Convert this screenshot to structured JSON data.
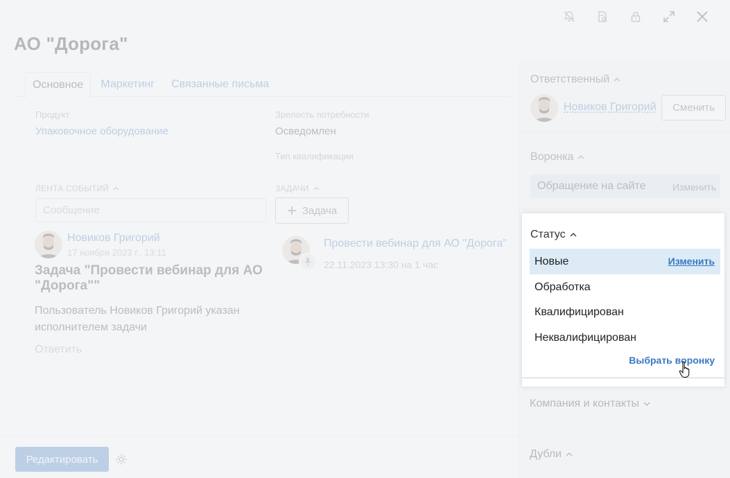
{
  "title": "АО \"Дорога\"",
  "tabs": [
    {
      "label": "Основное"
    },
    {
      "label": "Маркетинг"
    },
    {
      "label": "Связанные письма"
    }
  ],
  "fields": {
    "product_label": "Продукт",
    "product_value": "Упаковочное оборудование",
    "maturity_label": "Зрелость потребности",
    "maturity_value": "Осведомлен",
    "qual_label": "Тип квалификации"
  },
  "feed": {
    "header": "ЛЕНТА СОБЫТИЙ",
    "message_placeholder": "Сообщение",
    "author": "Новиков Григорий",
    "date": "17 ноября 2023 г., 13:11",
    "event_title": "Задача \"Провести вебинар для АО \"Дорога\"\"",
    "event_text": "Пользователь Новиков Григорий указан исполнителем задачи",
    "reply": "Ответить"
  },
  "tasks": {
    "header": "ЗАДАЧИ",
    "add_label": "Задача",
    "task_title": "Провести вебинар для АО \"Дорога\"",
    "task_date": "22.11.2023 13:30 на 1 час"
  },
  "footer": {
    "edit_label": "Редактировать"
  },
  "side": {
    "responsible_header": "Ответственный",
    "responsible_name": "Новиков Григорий",
    "change_label": "Сменить",
    "funnel_header": "Воронка",
    "funnel_name": "Обращение на сайте",
    "funnel_change": "Изменить",
    "company_header": "Компания и контакты",
    "duplicates_header": "Дубли"
  },
  "status_popup": {
    "header": "Статус",
    "items": [
      {
        "label": "Новые",
        "selected": true,
        "action": "Изменить"
      },
      {
        "label": "Обработка"
      },
      {
        "label": "Квалифицирован"
      },
      {
        "label": "Неквалифицирован"
      }
    ],
    "choose_funnel": "Выбрать воронку"
  },
  "colors": {
    "accent": "#3a78c2",
    "selected_bg": "#dcebf6"
  }
}
